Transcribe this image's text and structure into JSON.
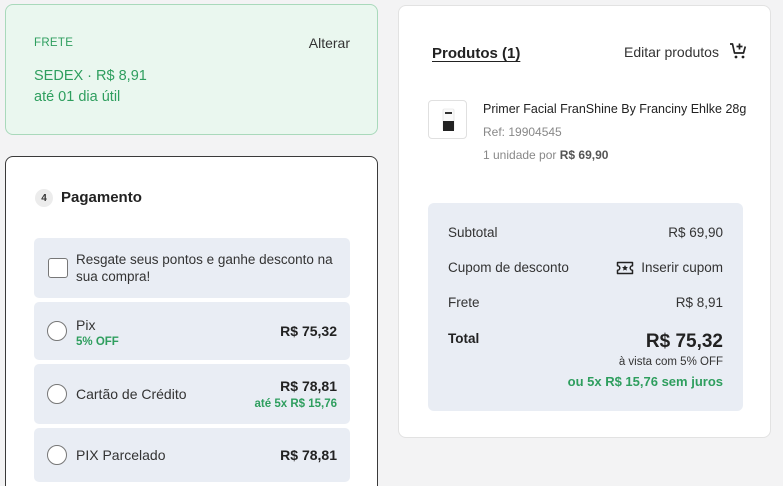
{
  "shipping": {
    "label": "FRETE",
    "change_label": "Alterar",
    "method": "SEDEX · R$ 8,91",
    "eta": "até 01 dia útil"
  },
  "payment": {
    "step": "4",
    "title": "Pagamento",
    "points_text": "Resgate seus pontos e ganhe desconto na sua compra!",
    "options": [
      {
        "label": "Pix",
        "sub": "5% OFF",
        "price": "R$ 75,32",
        "price_sub": ""
      },
      {
        "label": "Cartão de Crédito",
        "sub": "",
        "price": "R$ 78,81",
        "price_sub": "até 5x R$ 15,76"
      },
      {
        "label": "PIX Parcelado",
        "sub": "",
        "price": "R$ 78,81",
        "price_sub": ""
      }
    ]
  },
  "products": {
    "title": "Produtos (1)",
    "edit_label": "Editar produtos",
    "item": {
      "name": "Primer Facial FranShine By Franciny Ehlke 28g",
      "ref": "Ref: 19904545",
      "qty_prefix": "1 unidade por",
      "unit_price": "R$ 69,90"
    }
  },
  "summary": {
    "subtotal_label": "Subtotal",
    "subtotal_value": "R$ 69,90",
    "coupon_label": "Cupom de desconto",
    "coupon_button": "Inserir cupom",
    "shipping_label": "Frete",
    "shipping_value": "R$ 8,91",
    "total_label": "Total",
    "total_value": "R$ 75,32",
    "total_note": "à vista com 5% OFF",
    "installments": "ou 5x R$ 15,76 sem juros"
  },
  "colors": {
    "accent_green": "#2e9e5e",
    "panel_bg": "#e9edf4",
    "shipping_bg": "#eaf7ef"
  }
}
